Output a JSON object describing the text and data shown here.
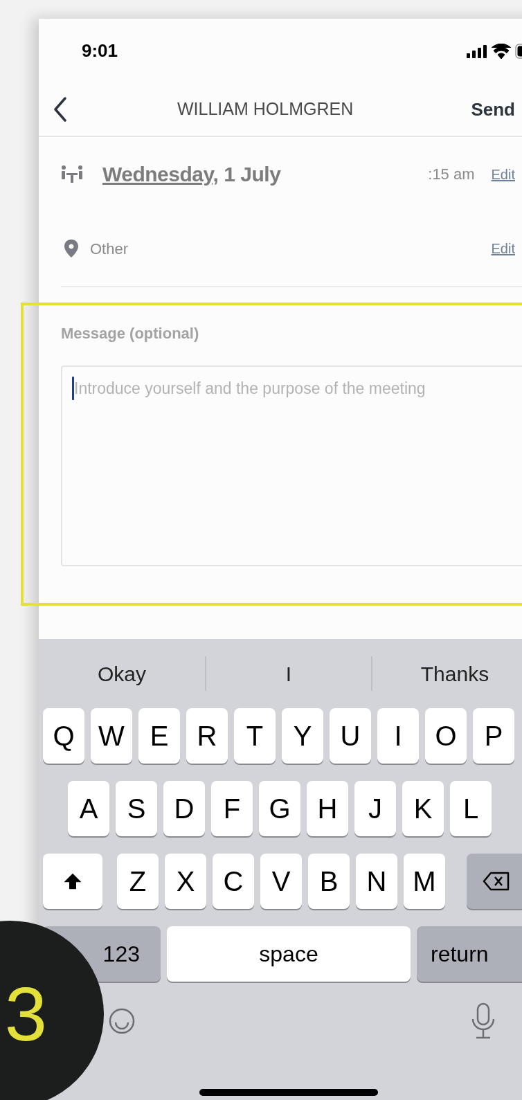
{
  "status_bar": {
    "time": "9:01"
  },
  "nav": {
    "title": "WILLIAM HOLMGREN",
    "action": "Send"
  },
  "details": [
    {
      "kind": "date",
      "date": "Wednesday,",
      "date_rest": "1 July",
      "time": ":15 am",
      "edit": "Edit"
    },
    {
      "kind": "location",
      "text": "Other",
      "edit": "Edit"
    }
  ],
  "message": {
    "label": "Message (optional)",
    "placeholder": "Introduce yourself and the purpose of the meeting",
    "focused": true
  },
  "keyboard": {
    "suggestions": [
      "Okay",
      "I",
      "Thanks"
    ],
    "rows": [
      {
        "keys": [
          {
            "kind": "letter",
            "label": "Q"
          },
          {
            "kind": "letter",
            "label": "W"
          },
          {
            "kind": "letter",
            "label": "E"
          },
          {
            "kind": "letter",
            "label": "R"
          },
          {
            "kind": "letter",
            "label": "T"
          },
          {
            "kind": "letter",
            "label": "Y"
          },
          {
            "kind": "letter",
            "label": "U"
          },
          {
            "kind": "letter",
            "label": "I"
          },
          {
            "kind": "letter",
            "label": "O"
          },
          {
            "kind": "letter",
            "label": "P"
          }
        ]
      },
      {
        "keys": [
          {
            "kind": "letter",
            "label": "A"
          },
          {
            "kind": "letter",
            "label": "S"
          },
          {
            "kind": "letter",
            "label": "D"
          },
          {
            "kind": "letter",
            "label": "F"
          },
          {
            "kind": "letter",
            "label": "G"
          },
          {
            "kind": "letter",
            "label": "H"
          },
          {
            "kind": "letter",
            "label": "J"
          },
          {
            "kind": "letter",
            "label": "K"
          },
          {
            "kind": "letter",
            "label": "L"
          }
        ]
      },
      {
        "keys": [
          {
            "kind": "shift"
          },
          {
            "kind": "letter",
            "label": "Z"
          },
          {
            "kind": "letter",
            "label": "X"
          },
          {
            "kind": "letter",
            "label": "C"
          },
          {
            "kind": "letter",
            "label": "V"
          },
          {
            "kind": "letter",
            "label": "B"
          },
          {
            "kind": "letter",
            "label": "N"
          },
          {
            "kind": "letter",
            "label": "M"
          },
          {
            "kind": "backspace"
          }
        ]
      },
      {
        "keys": [
          {
            "kind": "mode",
            "label": "123"
          },
          {
            "kind": "space",
            "label": "space"
          },
          {
            "kind": "return",
            "label": "return"
          }
        ]
      }
    ]
  },
  "annotation": {
    "step": "3"
  }
}
